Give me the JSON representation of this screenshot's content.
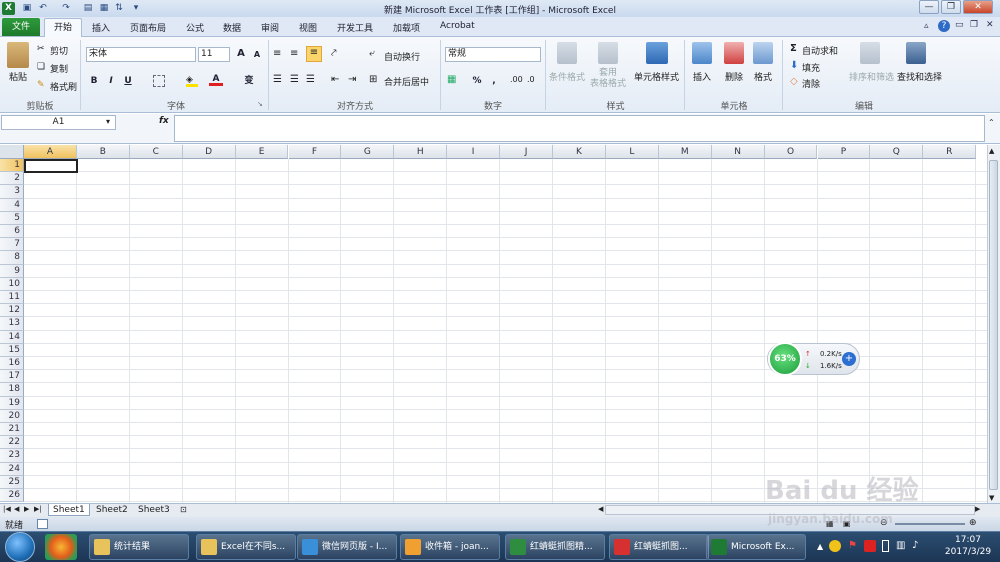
{
  "window": {
    "title": "新建 Microsoft Excel 工作表 [工作组] - Microsoft Excel"
  },
  "quick_access": {
    "save": "save-icon",
    "undo": "undo-icon",
    "redo": "redo-icon"
  },
  "tabs": {
    "file": "文件",
    "items": [
      "开始",
      "插入",
      "页面布局",
      "公式",
      "数据",
      "审阅",
      "视图",
      "开发工具",
      "加载项",
      "Acrobat"
    ]
  },
  "ribbon": {
    "clipboard": {
      "paste": "粘贴",
      "cut": "剪切",
      "copy": "复制",
      "format_painter": "格式刷",
      "label": "剪贴板"
    },
    "font": {
      "name": "宋体",
      "size": "11",
      "bold": "B",
      "italic": "I",
      "underline": "U",
      "font_color_glyph": "A",
      "phonetic": "变",
      "grow": "A",
      "shrink": "A",
      "label": "字体"
    },
    "alignment": {
      "wrap": "自动换行",
      "merge": "合并后居中",
      "label": "对齐方式"
    },
    "number": {
      "format": "常规",
      "percent": "%",
      "comma": ",",
      "label": "数字"
    },
    "styles": {
      "conditional": "条件格式",
      "table": "套用\n表格格式",
      "cell_styles": "单元格样式",
      "label": "样式"
    },
    "cells": {
      "insert": "插入",
      "delete": "删除",
      "format": "格式",
      "label": "单元格"
    },
    "editing": {
      "autosum": "自动求和",
      "fill": "填充",
      "clear": "清除",
      "sort": "排序和筛选",
      "find": "查找和选择",
      "label": "编辑"
    }
  },
  "formula_bar": {
    "name_box": "A1",
    "fx": "fx",
    "value": ""
  },
  "grid": {
    "columns": [
      "A",
      "B",
      "C",
      "D",
      "E",
      "F",
      "G",
      "H",
      "I",
      "J",
      "K",
      "L",
      "M",
      "N",
      "O",
      "P",
      "Q",
      "R"
    ],
    "rows": [
      "1",
      "2",
      "3",
      "4",
      "5",
      "6",
      "7",
      "8",
      "9",
      "10",
      "11",
      "12",
      "13",
      "14",
      "15",
      "16",
      "17",
      "18",
      "19",
      "20",
      "21",
      "22",
      "23",
      "24",
      "25",
      "26"
    ],
    "selected_cell": "A1"
  },
  "sheets": [
    "Sheet1",
    "Sheet2",
    "Sheet3"
  ],
  "status": {
    "mode": "就绪"
  },
  "widget": {
    "percent": "63%",
    "upload": "0.2K/s",
    "download": "1.6K/s"
  },
  "taskbar": {
    "items": [
      {
        "label": "统计结果",
        "icon": "folder-icon",
        "color": "#e8c25a"
      },
      {
        "label": "Excel在不同s...",
        "icon": "folder-icon",
        "color": "#e8c25a"
      },
      {
        "label": "微信网页版 - I...",
        "icon": "ie-icon",
        "color": "#3a8fd9"
      },
      {
        "label": "收件箱 - joan...",
        "icon": "outlook-icon",
        "color": "#f0a030"
      },
      {
        "label": "红蜻蜓抓图精...",
        "icon": "snip-icon",
        "color": "#2f8d3f"
      },
      {
        "label": "红蜻蜓抓图...",
        "icon": "snip-red-icon",
        "color": "#d63030"
      },
      {
        "label": "Microsoft Ex...",
        "icon": "excel-icon",
        "color": "#1f7a34"
      }
    ],
    "time": "17:07",
    "date": "2017/3/29"
  },
  "watermark": {
    "brand": "Bai du 经验",
    "url": "jingyan.baidu.com"
  },
  "colors": {
    "accent": "#1d7a2b",
    "ribbon_bg": "#e4ecf6",
    "taskbar": "#1c3554"
  }
}
